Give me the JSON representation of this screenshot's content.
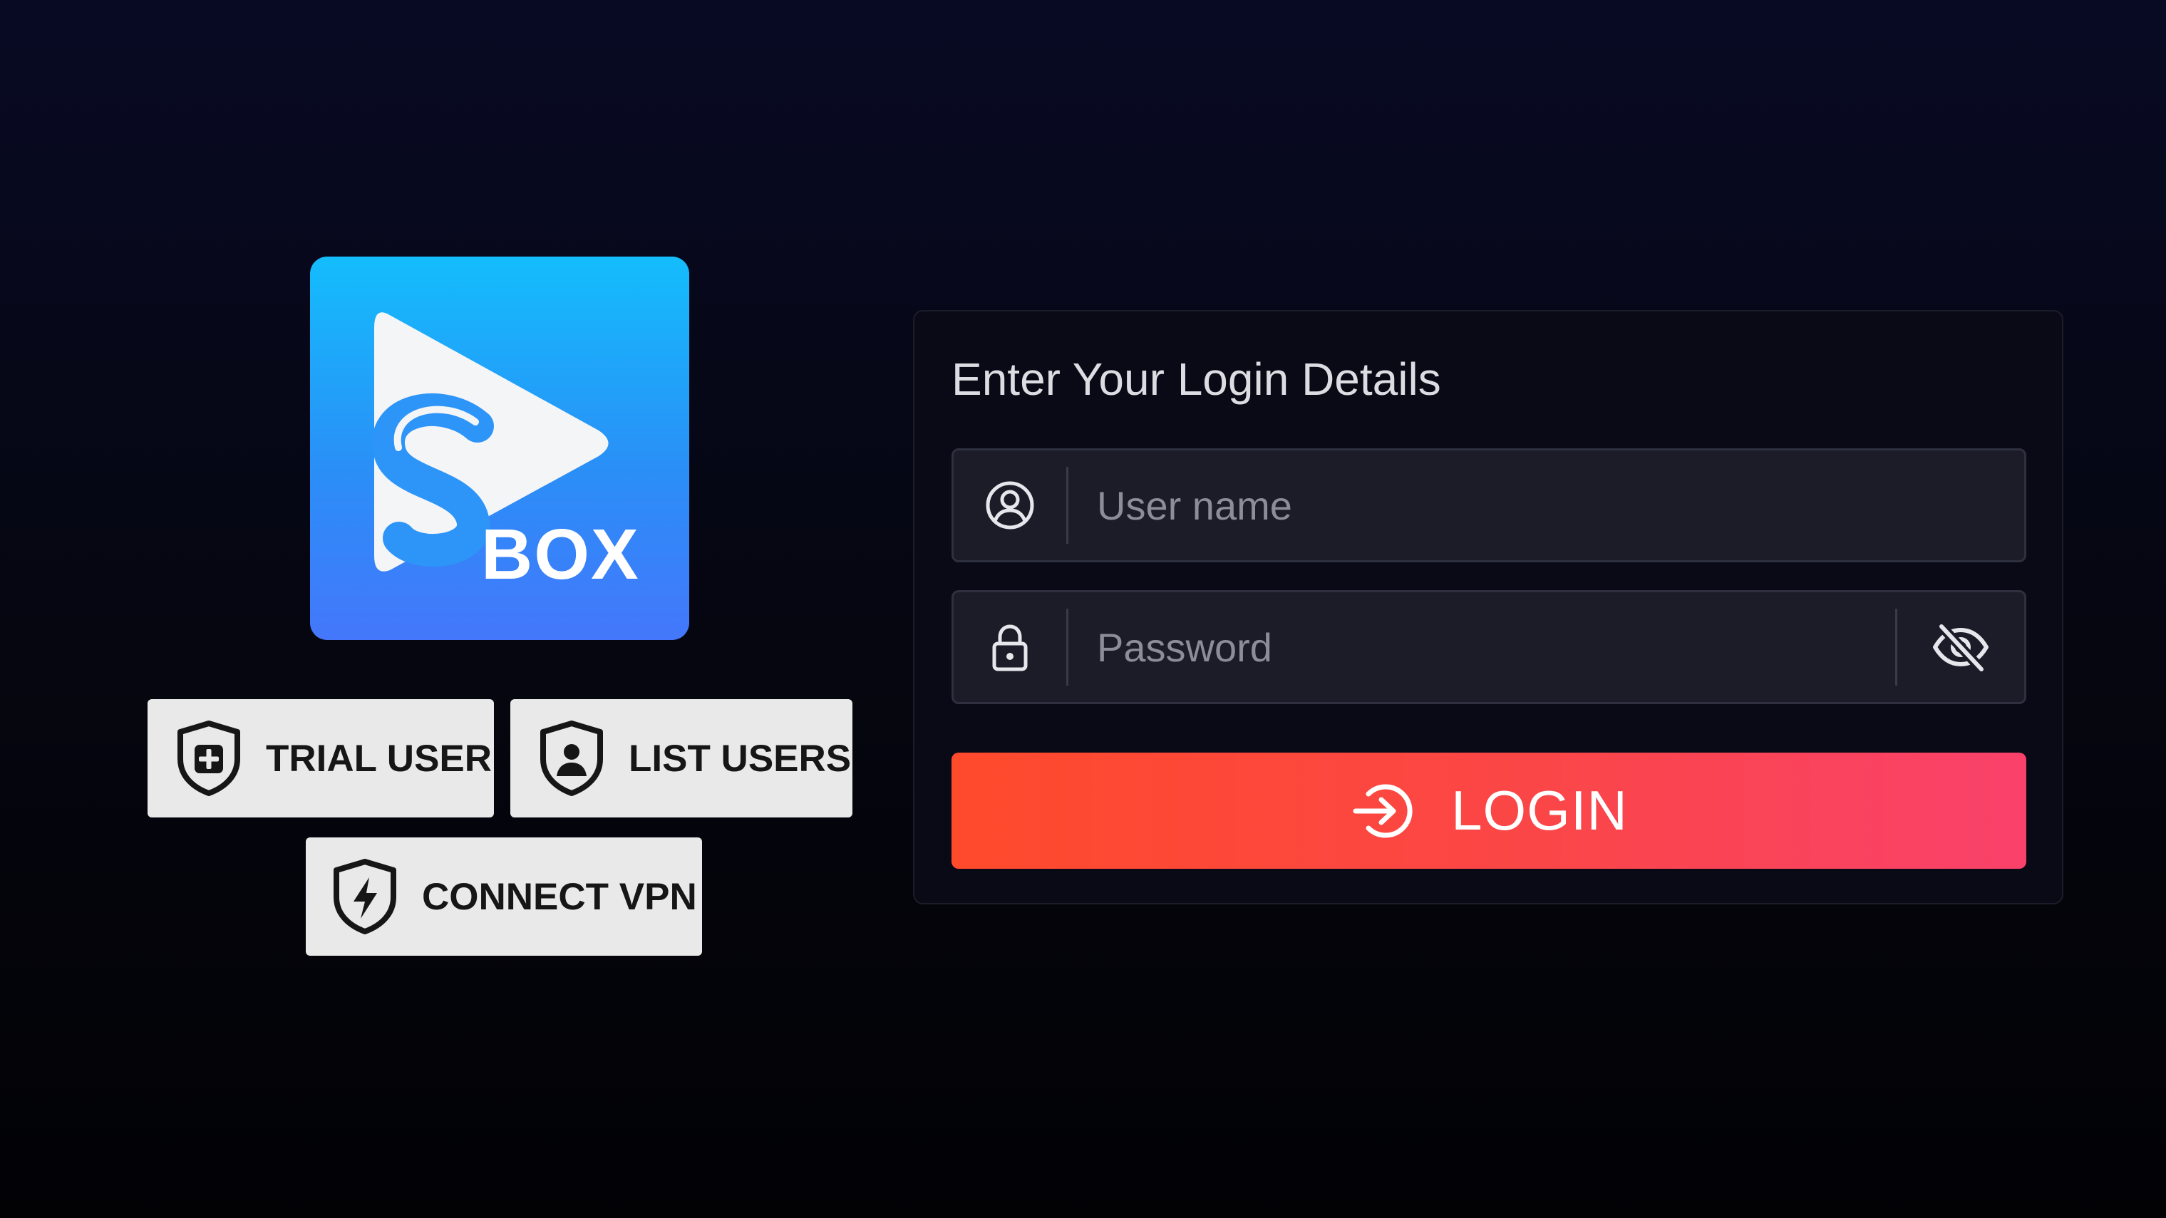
{
  "brand": {
    "logo_text": "BOX",
    "logo_colors": {
      "top": "#14bdfc",
      "bottom": "#4477fb"
    }
  },
  "actions": {
    "trial_user": {
      "label": "TRIAL USER",
      "icon": "shield-plus-icon"
    },
    "list_users": {
      "label": "LIST USERS",
      "icon": "shield-user-icon"
    },
    "connect_vpn": {
      "label": "CONNECT VPN",
      "icon": "shield-bolt-icon"
    }
  },
  "login": {
    "title": "Enter Your Login Details",
    "username": {
      "placeholder": "User name",
      "value": "",
      "icon": "user-circle-icon"
    },
    "password": {
      "placeholder": "Password",
      "value": "",
      "icon": "lock-icon",
      "toggle_icon": "eye-off-icon"
    },
    "button": {
      "label": "LOGIN",
      "icon": "login-arrow-icon"
    }
  },
  "colors": {
    "background": "#05060f",
    "card_background": "#090a15",
    "field_background": "#1b1c27",
    "login_gradient_start": "#ff4a2c",
    "login_gradient_end": "#f9416b",
    "action_button_background": "#e9e9e9"
  }
}
